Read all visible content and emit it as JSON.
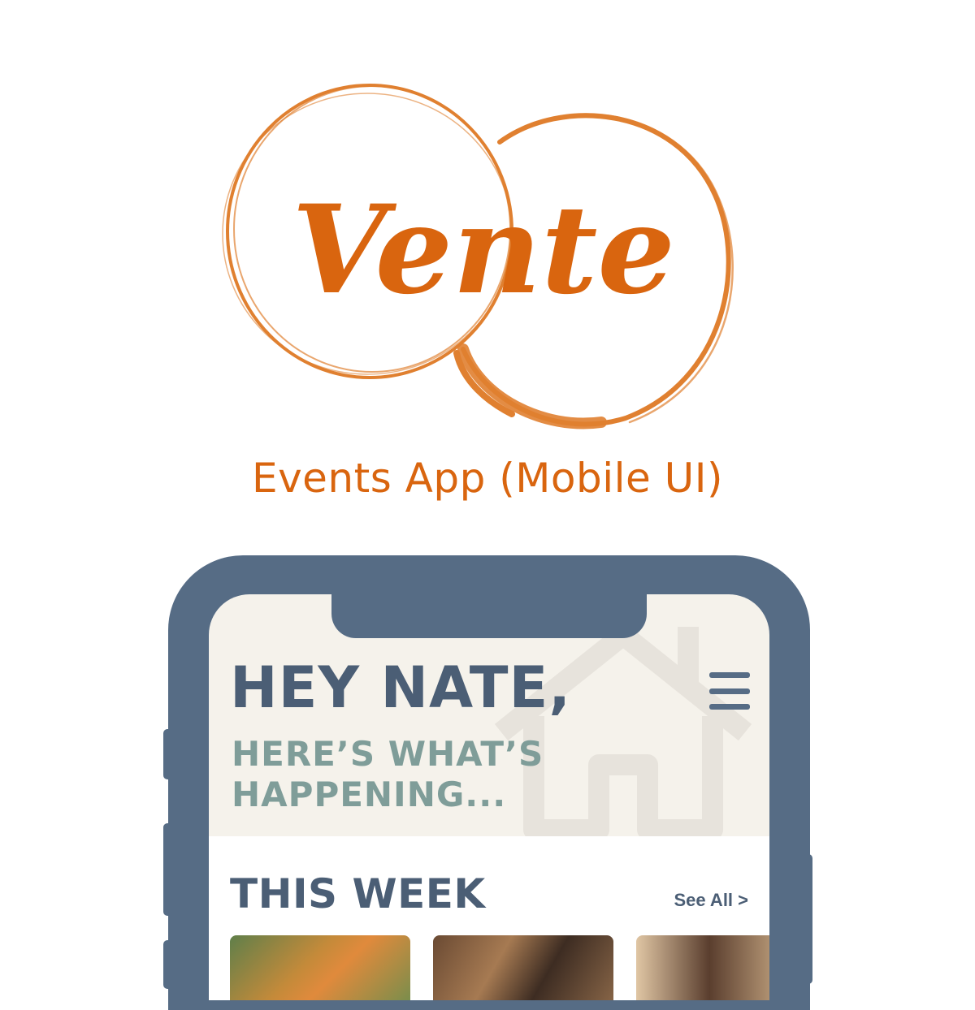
{
  "brand": {
    "logo_text": "Vente",
    "accent_color": "#d9650f",
    "ring_color": "#e08030"
  },
  "subtitle": "Events App (Mobile UI)",
  "phone": {
    "frame_color": "#566c85",
    "screen_bg": "#f5f2eb"
  },
  "header": {
    "greeting": "HEY NATE,",
    "tagline": "HERE’S WHAT’S HAPPENING...",
    "background_icon": "house-icon",
    "menu_icon": "hamburger-menu-icon"
  },
  "this_week": {
    "title": "THIS WEEK",
    "see_all": "See All >",
    "cards": [
      {
        "image": "market-produce-photo"
      },
      {
        "image": "guitar-photo"
      },
      {
        "image": "woman-portrait-photo"
      }
    ]
  }
}
